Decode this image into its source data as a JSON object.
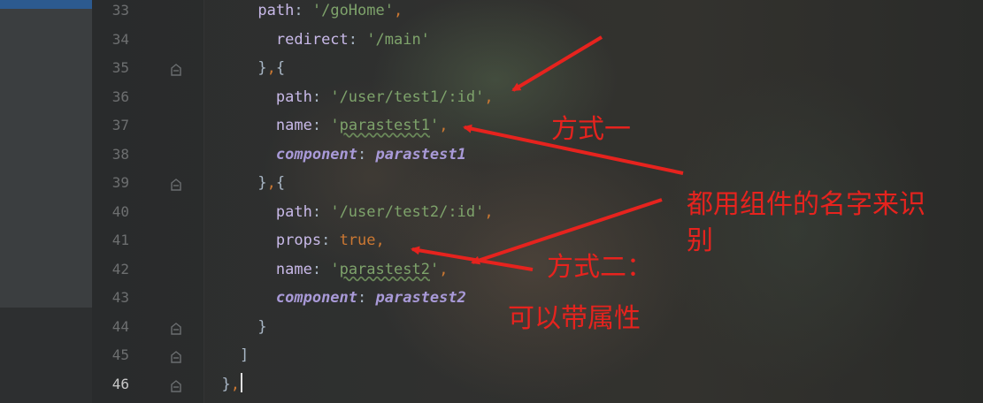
{
  "editor": {
    "lines": [
      {
        "number": "33",
        "indent": "      ",
        "parts": [
          [
            "key",
            "path"
          ],
          [
            "punc",
            ": "
          ],
          [
            "str",
            "'/goHome'"
          ],
          [
            "orange",
            ","
          ]
        ]
      },
      {
        "number": "34",
        "indent": "        ",
        "parts": [
          [
            "key",
            "redirect"
          ],
          [
            "punc",
            ": "
          ],
          [
            "str",
            "'/main'"
          ]
        ]
      },
      {
        "number": "35",
        "indent": "      ",
        "parts": [
          [
            "punc",
            "}"
          ],
          [
            "orange",
            ","
          ],
          [
            "punc",
            "{"
          ]
        ],
        "fold": true
      },
      {
        "number": "36",
        "indent": "        ",
        "parts": [
          [
            "key",
            "path"
          ],
          [
            "punc",
            ": "
          ],
          [
            "str",
            "'/user/test1/:id'"
          ],
          [
            "orange",
            ","
          ]
        ]
      },
      {
        "number": "37",
        "indent": "        ",
        "parts": [
          [
            "key",
            "name"
          ],
          [
            "punc",
            ": "
          ],
          [
            "str",
            "'"
          ],
          [
            "strsq",
            "parastest1"
          ],
          [
            "str",
            "'"
          ],
          [
            "orange",
            ","
          ]
        ]
      },
      {
        "number": "38",
        "indent": "        ",
        "parts": [
          [
            "italic",
            "component"
          ],
          [
            "punc",
            ": "
          ],
          [
            "italic",
            "parastest1"
          ]
        ]
      },
      {
        "number": "39",
        "indent": "      ",
        "parts": [
          [
            "punc",
            "}"
          ],
          [
            "orange",
            ","
          ],
          [
            "punc",
            "{"
          ]
        ],
        "fold": true
      },
      {
        "number": "40",
        "indent": "        ",
        "parts": [
          [
            "key",
            "path"
          ],
          [
            "punc",
            ": "
          ],
          [
            "str",
            "'/user/test2/:id'"
          ],
          [
            "orange",
            ","
          ]
        ]
      },
      {
        "number": "41",
        "indent": "        ",
        "parts": [
          [
            "key",
            "props"
          ],
          [
            "punc",
            ": "
          ],
          [
            "kw",
            "true"
          ],
          [
            "orange",
            ","
          ]
        ]
      },
      {
        "number": "42",
        "indent": "        ",
        "parts": [
          [
            "key",
            "name"
          ],
          [
            "punc",
            ": "
          ],
          [
            "str",
            "'"
          ],
          [
            "strsq",
            "parastest2"
          ],
          [
            "str",
            "'"
          ],
          [
            "orange",
            ","
          ]
        ]
      },
      {
        "number": "43",
        "indent": "        ",
        "parts": [
          [
            "italic",
            "component"
          ],
          [
            "punc",
            ": "
          ],
          [
            "italic",
            "parastest2"
          ]
        ]
      },
      {
        "number": "44",
        "indent": "      ",
        "parts": [
          [
            "punc",
            "}"
          ]
        ],
        "fold": true
      },
      {
        "number": "45",
        "indent": "    ",
        "parts": [
          [
            "punc",
            "]"
          ]
        ],
        "fold": true
      },
      {
        "number": "46",
        "indent": "  ",
        "parts": [
          [
            "punc",
            "}"
          ],
          [
            "orange",
            ","
          ]
        ],
        "fold": true,
        "current": true,
        "caret": true
      }
    ]
  },
  "annotations": {
    "method1": "方式一",
    "identify_line1": "都用组件的名字来识",
    "identify_line2": "别",
    "method2": "方式二：",
    "with_props": "可以带属性"
  },
  "colors": {
    "annotation_red": "#e6231e",
    "line_number": "#6d6f70",
    "key": "#c8b9e8",
    "string": "#7ea36b",
    "keyword": "#cc7832"
  }
}
